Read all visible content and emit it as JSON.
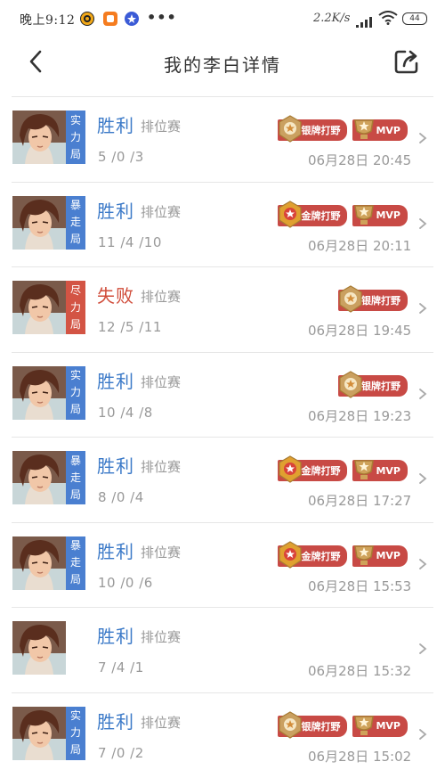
{
  "status_bar": {
    "time": "晚上9:12",
    "network_speed": "2.2K/s",
    "battery": "44"
  },
  "header": {
    "title": "我的李白详情"
  },
  "colors": {
    "blue_result": "#3c7ac8",
    "red_result": "#d04c3a",
    "badge_blue": "#4a7fd0",
    "badge_red": "#d35444",
    "badge_ribbon": "#c84a45"
  },
  "matches": [
    {
      "mode": "实力局",
      "mode_color": "blue",
      "result": "胜利",
      "result_color": "blue",
      "match_type": "排位赛",
      "kda": "5 /0 /3",
      "date": "06月28日 20:45",
      "badges": [
        {
          "label": "银牌打野",
          "kind": "silver"
        },
        {
          "label": "MVP",
          "kind": "mvp"
        }
      ]
    },
    {
      "mode": "暴走局",
      "mode_color": "blue",
      "result": "胜利",
      "result_color": "blue",
      "match_type": "排位赛",
      "kda": "11 /4 /10",
      "date": "06月28日 20:11",
      "badges": [
        {
          "label": "金牌打野",
          "kind": "gold"
        },
        {
          "label": "MVP",
          "kind": "mvp"
        }
      ]
    },
    {
      "mode": "尽力局",
      "mode_color": "red",
      "result": "失败",
      "result_color": "red",
      "match_type": "排位赛",
      "kda": "12 /5 /11",
      "date": "06月28日 19:45",
      "badges": [
        {
          "label": "银牌打野",
          "kind": "silver"
        }
      ]
    },
    {
      "mode": "实力局",
      "mode_color": "blue",
      "result": "胜利",
      "result_color": "blue",
      "match_type": "排位赛",
      "kda": "10 /4 /8",
      "date": "06月28日 19:23",
      "badges": [
        {
          "label": "银牌打野",
          "kind": "silver"
        }
      ]
    },
    {
      "mode": "暴走局",
      "mode_color": "blue",
      "result": "胜利",
      "result_color": "blue",
      "match_type": "排位赛",
      "kda": "8 /0 /4",
      "date": "06月28日 17:27",
      "badges": [
        {
          "label": "金牌打野",
          "kind": "gold"
        },
        {
          "label": "MVP",
          "kind": "mvp"
        }
      ]
    },
    {
      "mode": "暴走局",
      "mode_color": "blue",
      "result": "胜利",
      "result_color": "blue",
      "match_type": "排位赛",
      "kda": "10 /0 /6",
      "date": "06月28日 15:53",
      "badges": [
        {
          "label": "金牌打野",
          "kind": "gold"
        },
        {
          "label": "MVP",
          "kind": "mvp"
        }
      ]
    },
    {
      "mode": "",
      "mode_color": "none",
      "result": "胜利",
      "result_color": "blue",
      "match_type": "排位赛",
      "kda": "7 /4 /1",
      "date": "06月28日 15:32",
      "badges": []
    },
    {
      "mode": "实力局",
      "mode_color": "blue",
      "result": "胜利",
      "result_color": "blue",
      "match_type": "排位赛",
      "kda": "7 /0 /2",
      "date": "06月28日 15:02",
      "badges": [
        {
          "label": "银牌打野",
          "kind": "silver"
        },
        {
          "label": "MVP",
          "kind": "mvp"
        }
      ]
    }
  ]
}
